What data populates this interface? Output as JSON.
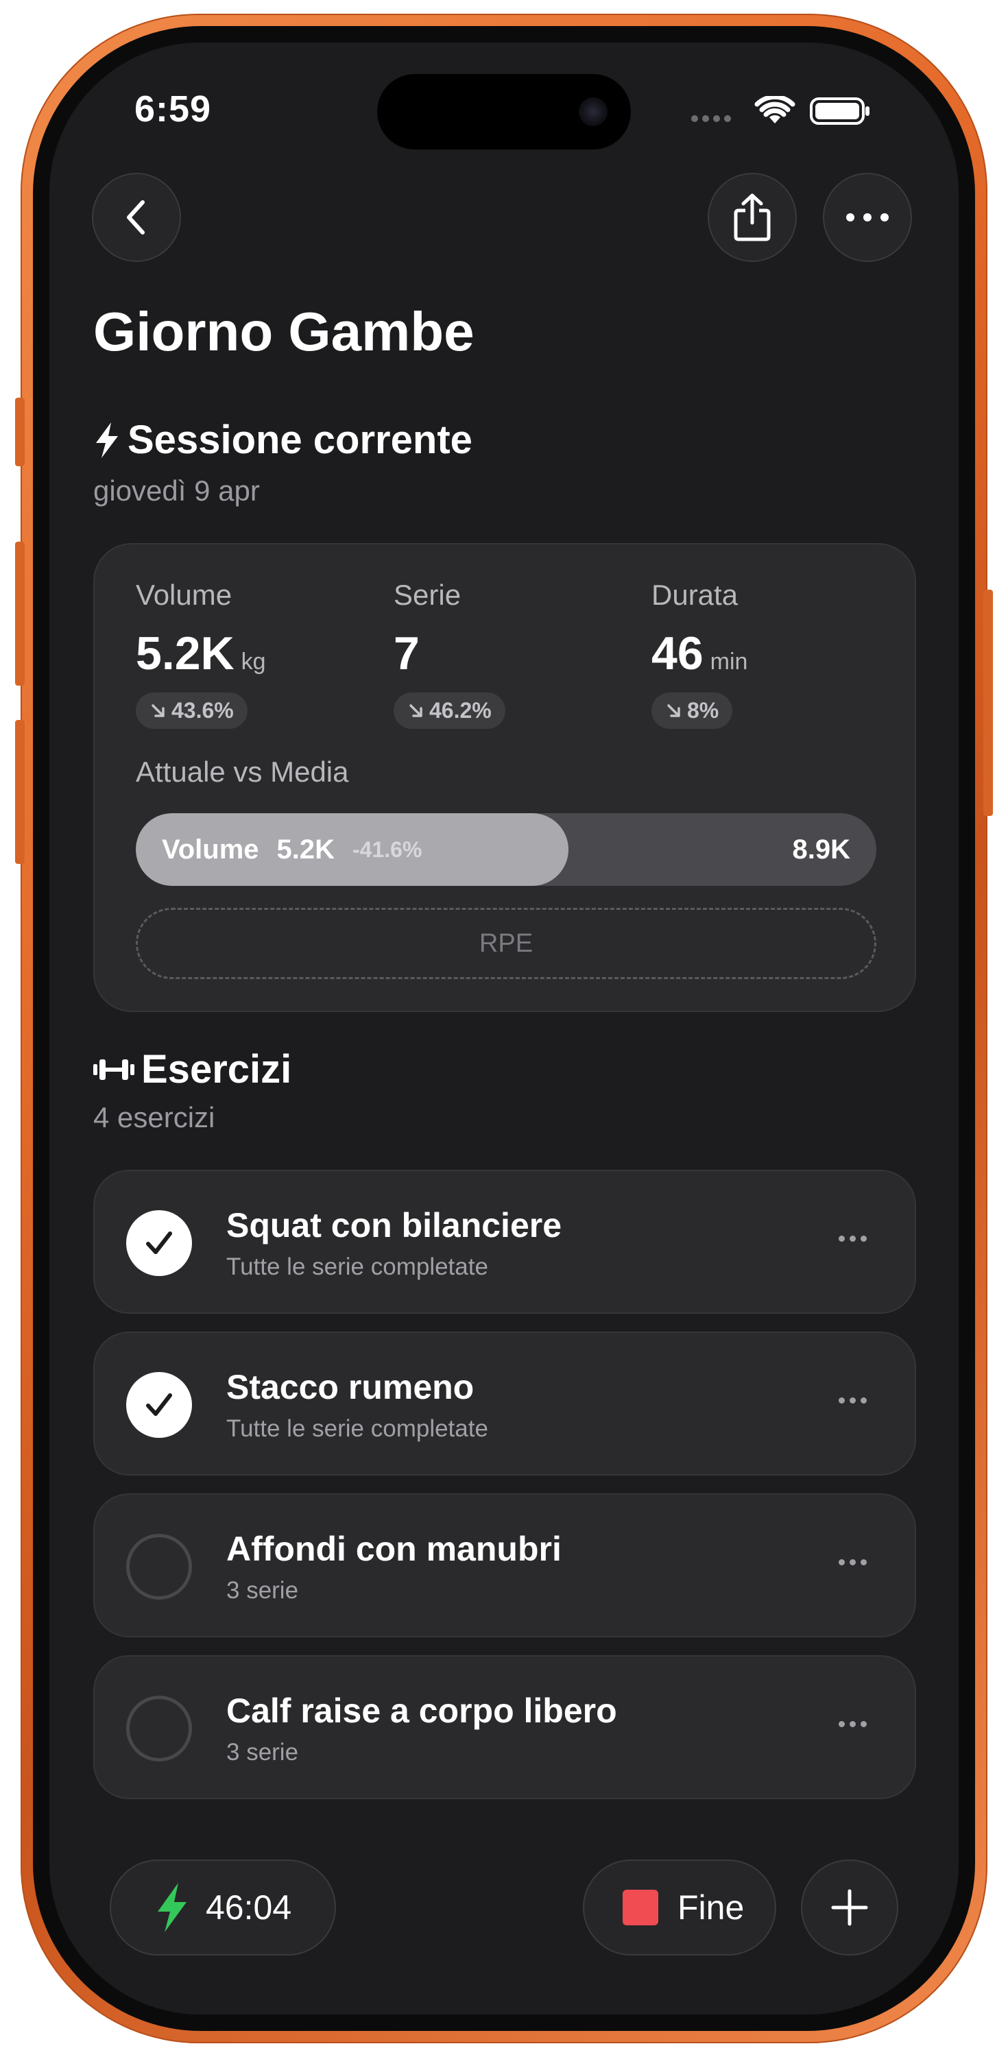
{
  "status_bar": {
    "time": "6:59"
  },
  "nav": {
    "back_icon": "chevron-left-icon",
    "share_icon": "share-icon",
    "more_icon": "ellipsis-icon"
  },
  "page": {
    "title": "Giorno Gambe"
  },
  "session": {
    "heading": "Sessione corrente",
    "icon": "bolt-icon",
    "date": "giovedì 9 apr",
    "stats": [
      {
        "label": "Volume",
        "value": "5.2K",
        "unit": "kg",
        "change": "43.6%"
      },
      {
        "label": "Serie",
        "value": "7",
        "unit": "",
        "change": "46.2%"
      },
      {
        "label": "Durata",
        "value": "46",
        "unit": "min",
        "change": "8%"
      }
    ],
    "compare": {
      "label": "Attuale vs Media",
      "metric": "Volume",
      "current": "5.2K",
      "delta": "-41.6%",
      "average": "8.9K",
      "fill_fraction": 0.584
    },
    "rpe_label": "RPE"
  },
  "exercises": {
    "heading": "Esercizi",
    "icon": "dumbbell-icon",
    "count_label": "4 esercizi",
    "items": [
      {
        "name": "Squat con bilanciere",
        "detail": "Tutte le serie completate",
        "done": true
      },
      {
        "name": "Stacco rumeno",
        "detail": "Tutte le serie completate",
        "done": true
      },
      {
        "name": "Affondi con manubri",
        "detail": "3 serie",
        "done": false
      },
      {
        "name": "Calf raise a corpo libero",
        "detail": "3 serie",
        "done": false
      }
    ]
  },
  "bottom_bar": {
    "timer": "46:04",
    "finish_label": "Fine",
    "accent_green": "#34c759",
    "stop_red": "#f04c52"
  }
}
